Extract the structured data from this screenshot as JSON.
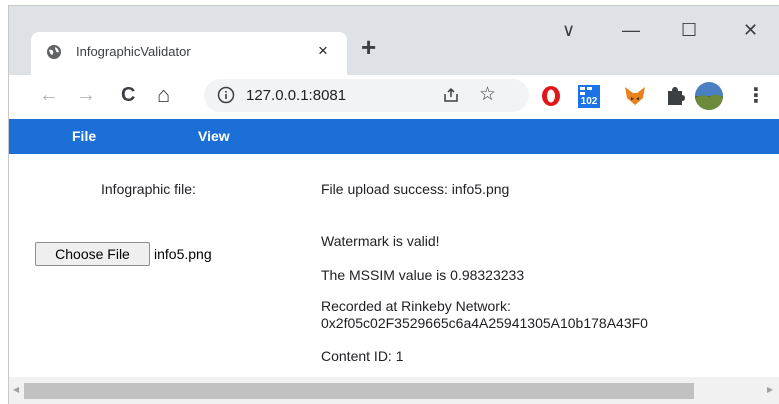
{
  "browser": {
    "tab_title": "InfographicValidator",
    "tab_close": "×",
    "new_tab": "+",
    "url": "127.0.0.1:8081",
    "window_controls": {
      "menu": "∨",
      "minimize": "—",
      "maximize": "☐",
      "close": "✕"
    },
    "nav": {
      "back": "←",
      "forward": "→",
      "reload": "C",
      "home": "⌂"
    },
    "star": "☆",
    "extensions": [
      "opera-icon",
      "counter-badge-icon",
      "fox-icon",
      "puzzle-icon",
      "avatar",
      "kebab-menu-icon"
    ],
    "ext_badge": "102",
    "menu_dots": "⋮"
  },
  "menubar": {
    "items": [
      "File",
      "View"
    ],
    "color": "#1b6fd6"
  },
  "content": {
    "file_label": "Infographic file:",
    "choose_button": "Choose File",
    "chosen_file": "info5.png",
    "upload_msg": "File upload success: info5.png",
    "watermark_msg": "Watermark is valid!",
    "mssim_msg": "The MSSIM value is 0.98323233",
    "recorded_msg_line1": "Recorded at Rinkeby Network:",
    "recorded_msg_line2": "0x2f05c02F3529665c6a4A25941305A10b178A43F0",
    "content_id": "Content ID: 1"
  },
  "scrollbar": {
    "left_arrow": "◀",
    "right_arrow": "▶"
  }
}
